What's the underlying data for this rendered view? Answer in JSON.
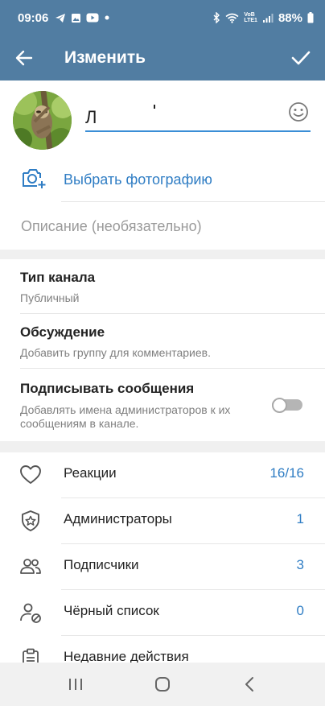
{
  "status_bar": {
    "time": "09:06",
    "battery": "88%",
    "network_label_top": "VoB",
    "network_label_bottom": "LTE1",
    "app_icons": [
      "telegram-icon",
      "image-icon",
      "youtube-icon",
      "dot-icon"
    ],
    "sys_icons": [
      "bluetooth-icon",
      "wifi-icon",
      "signal-icon",
      "battery-icon"
    ]
  },
  "toolbar": {
    "title": "Изменить",
    "back_icon": "arrow-left-icon",
    "done_icon": "check-icon"
  },
  "profile": {
    "name_value": "Л",
    "pick_photo_label": "Выбрать фотографию",
    "description_placeholder": "Описание (необязательно)"
  },
  "settings": {
    "channel_type": {
      "title": "Тип канала",
      "value": "Публичный"
    },
    "discussion": {
      "title": "Обсуждение",
      "subtitle": "Добавить группу для комментариев."
    },
    "sign_messages": {
      "title": "Подписывать сообщения",
      "subtitle_line1": "Добавлять имена администраторов к их",
      "subtitle_line2": "сообщениям в канале.",
      "enabled": false
    }
  },
  "list": [
    {
      "label": "Реакции",
      "value": "16/16",
      "icon": "heart-icon"
    },
    {
      "label": "Администраторы",
      "value": "1",
      "icon": "shield-star-icon"
    },
    {
      "label": "Подписчики",
      "value": "3",
      "icon": "users-icon"
    },
    {
      "label": "Чёрный список",
      "value": "0",
      "icon": "user-blocked-icon"
    },
    {
      "label": "Недавние действия",
      "value": "",
      "icon": "clipboard-icon"
    }
  ],
  "colors": {
    "header": "#517da2",
    "accent": "#2f7dc4",
    "underline": "#3a8ed6"
  }
}
